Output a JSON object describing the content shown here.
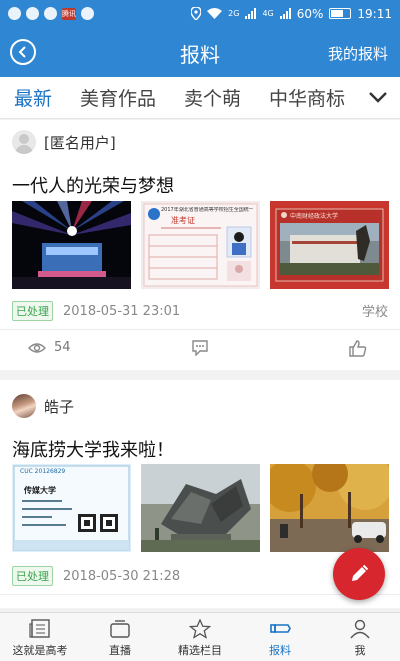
{
  "status_bar": {
    "time": "19:11",
    "battery": "60%",
    "network_2g": "2G",
    "network_4g": "4G",
    "app_icon_text": "腾讯"
  },
  "header": {
    "title": "报料",
    "right_link": "我的报料",
    "color": "#2f86d2"
  },
  "tabs": [
    {
      "label": "最新",
      "active": true
    },
    {
      "label": "美育作品",
      "active": false
    },
    {
      "label": "卖个萌",
      "active": false
    },
    {
      "label": "中华商标",
      "active": false
    }
  ],
  "posts": [
    {
      "username": "[匿名用户]",
      "title": "一代人的光荣与梦想",
      "status": "已处理",
      "datetime": "2018-05-31 23:01",
      "category": "学校",
      "views": "54",
      "images": [
        {
          "icon": "stage-concert-photo"
        },
        {
          "icon": "exam-admission-ticket-photo",
          "heading": "准考证",
          "caption": "2017年湖北省普通高等学校招生全国统一考试"
        },
        {
          "icon": "university-gate-photo",
          "sign": "中南财经政法大学"
        }
      ]
    },
    {
      "username": "皓子",
      "title": "海底捞大学我来啦！",
      "status": "已处理",
      "datetime": "2018-05-30 21:28",
      "images": [
        {
          "icon": "university-ticket-photo",
          "heading": "传媒大学",
          "ticket_code": "CUC 20126829"
        },
        {
          "icon": "campus-sculpture-photo"
        },
        {
          "icon": "autumn-campus-road-photo"
        }
      ]
    }
  ],
  "bottom_nav": [
    {
      "label": "这就是高考",
      "icon": "newspaper-icon",
      "active": false
    },
    {
      "label": "直播",
      "icon": "tv-icon",
      "active": false
    },
    {
      "label": "精选栏目",
      "icon": "star-icon",
      "active": false
    },
    {
      "label": "报料",
      "icon": "megaphone-icon",
      "active": true
    },
    {
      "label": "我",
      "icon": "person-icon",
      "active": false
    }
  ],
  "colors": {
    "accent": "#1a73c5",
    "badge_green": "#3aa34a",
    "fab_red": "#d7262d"
  }
}
